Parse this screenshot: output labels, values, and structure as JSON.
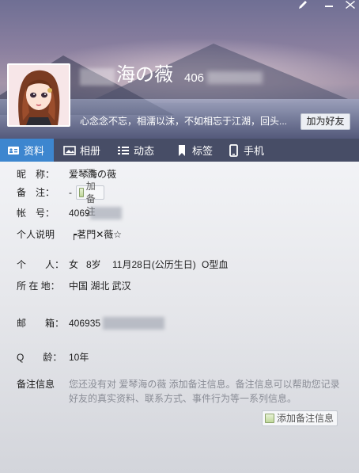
{
  "window_controls": {
    "edit_icon": "pencil-icon",
    "minimize_icon": "minimize-icon",
    "close_icon": "close-icon"
  },
  "header": {
    "nickname": "海の薇",
    "qq_number_visible": "406",
    "signature": "心念念不忘，相濡以沫，不如相忘于江湖，回头...",
    "add_friend_label": "加为好友"
  },
  "tabs": [
    {
      "label": "资料",
      "icon": "profile-card-icon",
      "active": true
    },
    {
      "label": "相册",
      "icon": "photo-album-icon",
      "active": false
    },
    {
      "label": "动态",
      "icon": "feed-list-icon",
      "active": false
    },
    {
      "label": "标签",
      "icon": "bookmark-icon",
      "active": false
    },
    {
      "label": "手机",
      "icon": "mobile-phone-icon",
      "active": false
    }
  ],
  "profile": {
    "nickname_label": "昵　称：",
    "nickname_value": "爱琴海の薇",
    "remark_label": "备　注：",
    "remark_value": "-",
    "add_remark_label": "添加备注",
    "account_label": "帐　号：",
    "account_value": "4069",
    "bio_label": "个人说明",
    "bio_value": "┍茗門✕薇☆",
    "personal_label": "个　　人：",
    "gender": "女",
    "age": "8岁",
    "birthday": "11月28日(公历生日)",
    "blood_type": "O型血",
    "location_label": "所 在 地：",
    "location_value": "中国 湖北 武汉",
    "email_label": "邮　　箱：",
    "email_value": "406935",
    "q_age_label": "Q　　龄：",
    "q_age_value": "10年",
    "note_info_label": "备注信息",
    "note_info_text": "您还没有对 爱琴海の薇 添加备注信息。备注信息可以帮助您记录好友的真实资料、联系方式、事件行为等一系列信息。",
    "add_note_info_label": "添加备注信息"
  }
}
